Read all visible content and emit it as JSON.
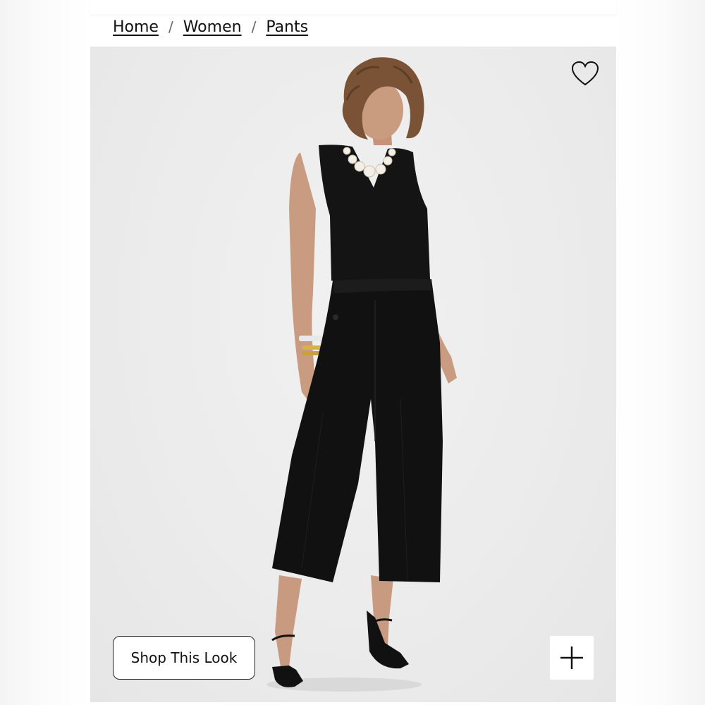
{
  "breadcrumb": {
    "items": [
      {
        "label": "Home"
      },
      {
        "label": "Women"
      },
      {
        "label": "Pants"
      }
    ],
    "separator": "/"
  },
  "product": {
    "shop_look_label": "Shop This Look"
  },
  "icons": {
    "wishlist": "heart-icon",
    "expand": "plus-icon"
  },
  "colors": {
    "text": "#111111",
    "photo_bg": "#ebebeb",
    "garment": "#151515"
  }
}
